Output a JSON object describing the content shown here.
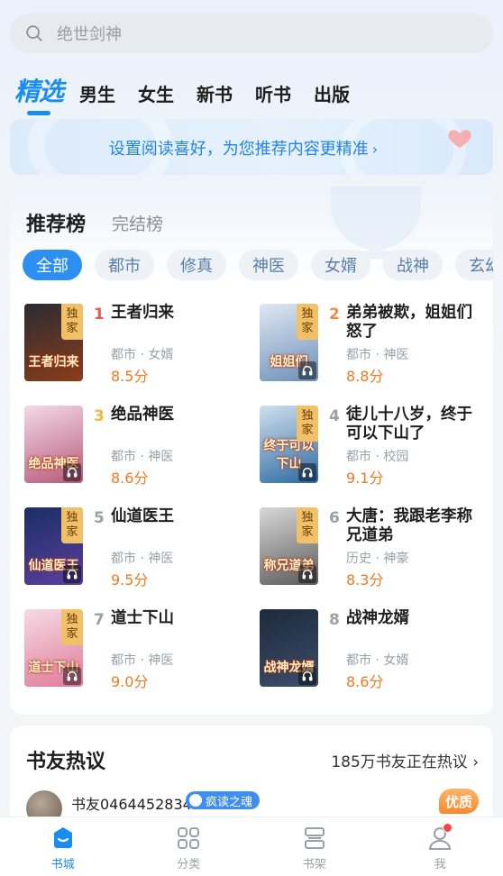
{
  "search": {
    "placeholder": "绝世剑神"
  },
  "channels": {
    "active": "精选",
    "items": [
      "男生",
      "女生",
      "新书",
      "听书",
      "出版"
    ]
  },
  "banner": {
    "text": "设置阅读喜好，为您推荐内容更精准",
    "chevron": "›"
  },
  "ranking": {
    "tabs": [
      "推荐榜",
      "完结榜"
    ],
    "chips": [
      "全部",
      "都市",
      "修真",
      "神医",
      "女婿",
      "战神",
      "玄幻"
    ],
    "exclusive_badge": [
      "独",
      "家"
    ],
    "books": [
      {
        "rank": "1",
        "title": "王者归来",
        "tags": "都市 · 女婿",
        "score": "8.5分",
        "cover_text": "王者归来",
        "exclusive": true,
        "audio": false,
        "cover_colors": [
          "#2b2b33",
          "#8a3d1a"
        ]
      },
      {
        "rank": "2",
        "title": "弟弟被欺，姐姐们怒了",
        "tags": "都市 · 神医",
        "score": "8.8分",
        "cover_text": "姐姐们",
        "exclusive": true,
        "audio": true,
        "cover_colors": [
          "#dfe8f3",
          "#6d8fb8"
        ]
      },
      {
        "rank": "3",
        "title": "绝品神医",
        "tags": "都市 · 神医",
        "score": "8.6分",
        "cover_text": "绝品神医",
        "exclusive": false,
        "audio": true,
        "cover_colors": [
          "#f3d9e6",
          "#b75a7a"
        ]
      },
      {
        "rank": "4",
        "title": "徒儿十八岁，终于可以下山了",
        "tags": "都市 · 校园",
        "score": "9.1分",
        "cover_text": "终于可以下山",
        "exclusive": true,
        "audio": true,
        "cover_colors": [
          "#cfe0ee",
          "#2d6aa0"
        ]
      },
      {
        "rank": "5",
        "title": "仙道医王",
        "tags": "都市 · 神医",
        "score": "9.5分",
        "cover_text": "仙道医王",
        "exclusive": true,
        "audio": true,
        "cover_colors": [
          "#1b2e66",
          "#5b3f9e"
        ]
      },
      {
        "rank": "6",
        "title": "大唐：我跟老李称兄道弟",
        "tags": "历史 · 神豪",
        "score": "8.3分",
        "cover_text": "称兄道弟",
        "exclusive": true,
        "audio": true,
        "cover_colors": [
          "#d8d8d8",
          "#5a5a5a"
        ]
      },
      {
        "rank": "7",
        "title": "道士下山",
        "tags": "都市 · 神医",
        "score": "9.0分",
        "cover_text": "道士下山",
        "exclusive": true,
        "audio": true,
        "cover_colors": [
          "#f6dbe4",
          "#e07a9a"
        ]
      },
      {
        "rank": "8",
        "title": "战神龙婿",
        "tags": "都市 · 女婿",
        "score": "8.6分",
        "cover_text": "战神龙婿",
        "exclusive": false,
        "audio": true,
        "cover_colors": [
          "#1e2a3c",
          "#3b4e6a"
        ]
      }
    ]
  },
  "discussion": {
    "title": "书友热议",
    "more": "185万书友正在热议",
    "user": "书友0464452834",
    "user_badge": "疯读之魂",
    "quality_tag": "优质"
  },
  "bottom_nav": [
    {
      "label": "书城",
      "icon": "bookstore-icon",
      "active": true
    },
    {
      "label": "分类",
      "icon": "category-grid-icon",
      "active": false
    },
    {
      "label": "书架",
      "icon": "bookshelf-icon",
      "active": false
    },
    {
      "label": "我",
      "icon": "profile-icon",
      "active": false,
      "notification_dot": true
    }
  ],
  "colors": {
    "accent": "#1a8df0",
    "score": "#f07a22",
    "rank1": "#f2584a",
    "rank2": "#f28a3c",
    "rank3": "#f4b73a"
  }
}
